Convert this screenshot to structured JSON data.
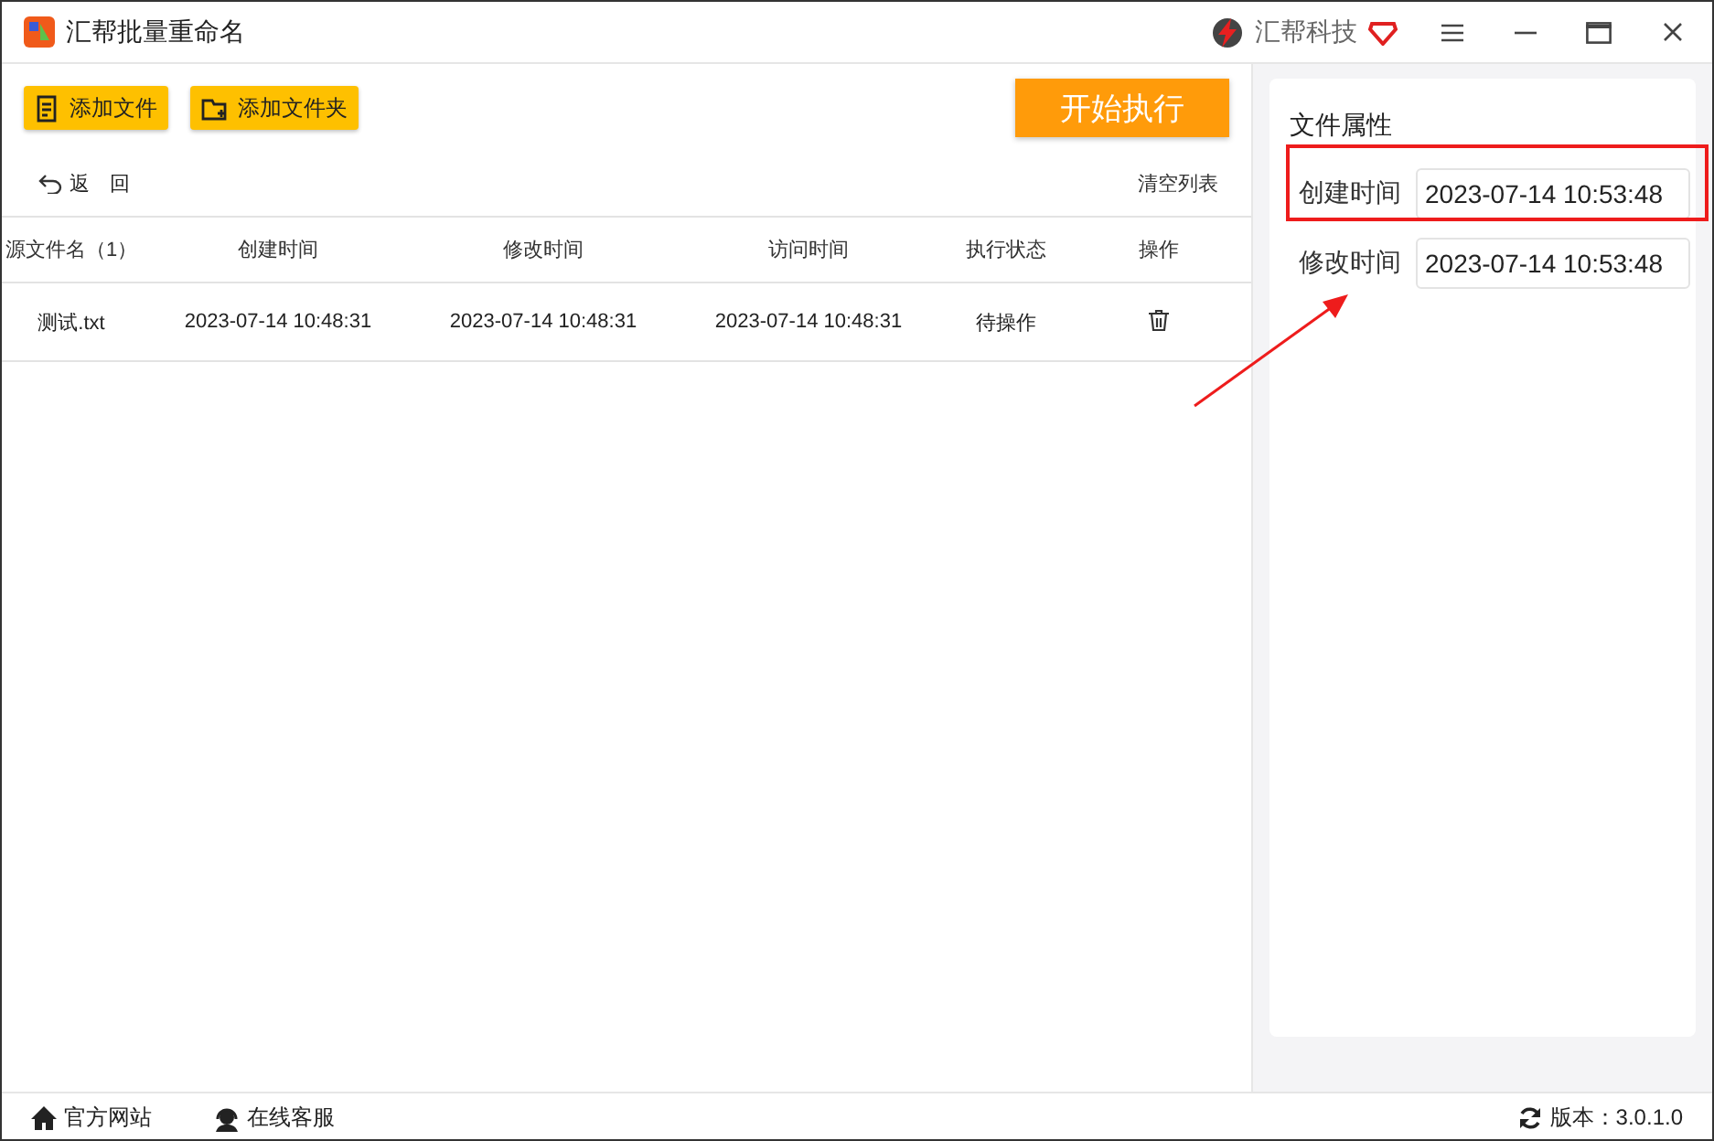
{
  "window": {
    "title": "汇帮批量重命名",
    "brand": "汇帮科技"
  },
  "toolbar": {
    "buttons": [
      {
        "label": "添加文件",
        "kind": "file"
      },
      {
        "label": "添加文件夹",
        "kind": "folder"
      }
    ],
    "start_button": "开始执行"
  },
  "list_bar": {
    "back": "返 回",
    "clear": "清空列表"
  },
  "table": {
    "columns": [
      "源文件名（1）",
      "创建时间",
      "修改时间",
      "访问时间",
      "执行状态",
      "操作"
    ],
    "rows": [
      {
        "cells": [
          "测试.txt",
          "2023-07-14 10:48:31",
          "2023-07-14 10:48:31",
          "2023-07-14 10:48:31",
          "待操作"
        ]
      }
    ]
  },
  "properties": {
    "title": "文件属性",
    "fields": [
      {
        "label": "创建时间",
        "value": "2023-07-14 10:53:48"
      },
      {
        "label": "修改时间",
        "value": "2023-07-14 10:53:48"
      }
    ]
  },
  "status_bar": {
    "links": [
      {
        "label": "官方网站",
        "kind": "home"
      },
      {
        "label": "在线客服",
        "kind": "support"
      }
    ],
    "version": "版本：3.0.1.0"
  }
}
